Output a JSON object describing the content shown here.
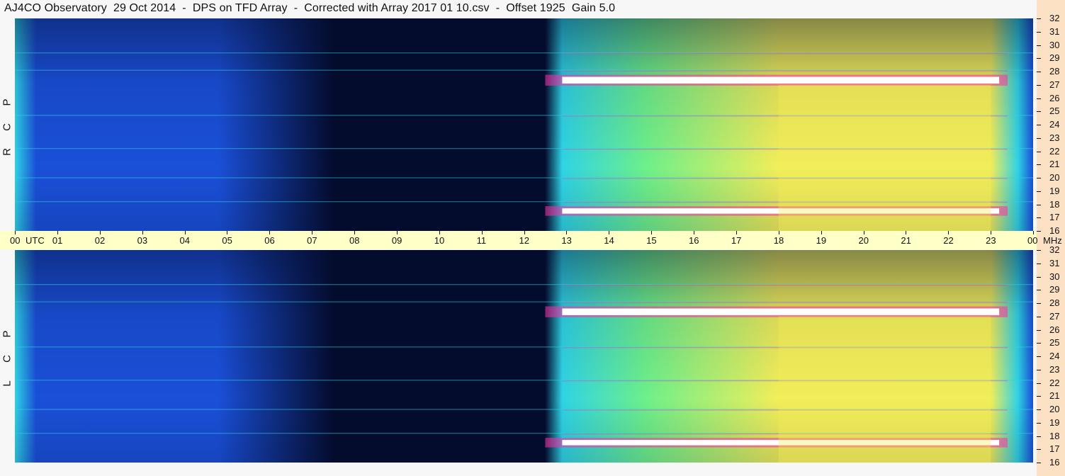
{
  "title": "AJ4CO Observatory  29 Oct 2014  -  DPS on TFD Array  -  Corrected with Array 2017 01 10.csv  -  Offset 1925  Gain 5.0",
  "colors": {
    "background": "#f7f7f7",
    "time_axis_strip": "#ffffc8",
    "freq_axis_strip": "#fde1c4",
    "night_dark": "#040c2e",
    "low_blue": "#1a4fd8",
    "mid_cyan": "#2fd4e6",
    "green": "#6ef08a",
    "yellow": "#f2ee5a",
    "magenta_rfi": "#ff2ea8",
    "white_saturated": "#ffffff"
  },
  "chart_data": {
    "type": "heatmap",
    "description_free": true,
    "x_axis": {
      "unit_label": "UTC",
      "range": [
        0,
        24
      ],
      "tick_labels": [
        "00",
        "01",
        "02",
        "03",
        "04",
        "05",
        "06",
        "07",
        "08",
        "09",
        "10",
        "11",
        "12",
        "13",
        "14",
        "15",
        "16",
        "17",
        "18",
        "19",
        "20",
        "21",
        "22",
        "23",
        "00"
      ]
    },
    "y_axis": {
      "unit_label": "MHz",
      "range": [
        16,
        32
      ],
      "tick_labels": [
        "32",
        "31",
        "30",
        "29",
        "28",
        "27",
        "26",
        "25",
        "24",
        "23",
        "22",
        "21",
        "20",
        "19",
        "18",
        "17",
        "16"
      ]
    },
    "panels": [
      {
        "id": "rcp",
        "letters": [
          "R",
          "C",
          "P"
        ]
      },
      {
        "id": "lcp",
        "letters": [
          "L",
          "C",
          "P"
        ]
      }
    ],
    "features": {
      "night_start_utc": 0.5,
      "night_end_utc": 12.9,
      "night_deepest_utc": [
        7.5,
        12.5
      ],
      "day_peak_utc": [
        18,
        23
      ],
      "strong_band_mhz": [
        17.3,
        17.7,
        27.1,
        27.6
      ],
      "weak_band_mhz": [
        18.2,
        20.0,
        22.2,
        24.7,
        28.1,
        29.4
      ]
    }
  }
}
